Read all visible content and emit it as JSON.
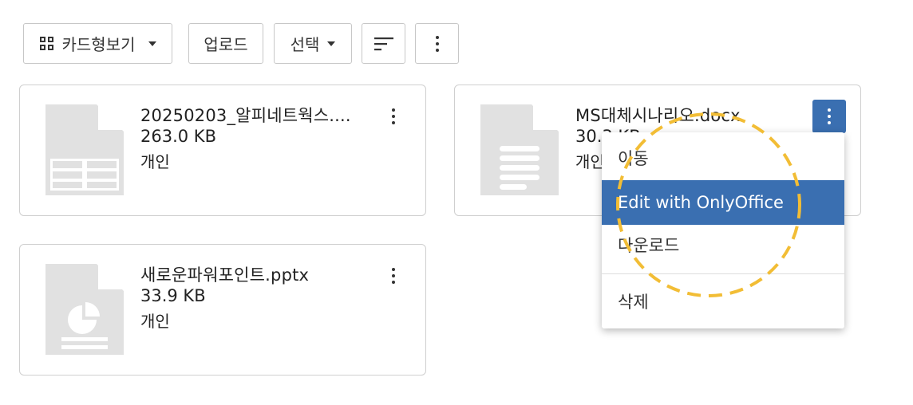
{
  "toolbar": {
    "view_label": "카드형보기",
    "upload_label": "업로드",
    "select_label": "선택"
  },
  "files": [
    {
      "name": "20250203_알피네트웍스....",
      "size": "263.0 KB",
      "owner": "개인",
      "icon": "spreadsheet-file-icon"
    },
    {
      "name": "MS대체시나리오.docx",
      "size": "30.3 KB",
      "owner": "개인",
      "icon": "document-file-icon"
    },
    {
      "name": "새로운파워포인트.pptx",
      "size": "33.9 KB",
      "owner": "개인",
      "icon": "presentation-file-icon"
    }
  ],
  "context_menu": {
    "items": [
      {
        "label": "이동"
      },
      {
        "label": "Edit with OnlyOffice",
        "highlighted": true
      },
      {
        "label": "다운로드"
      },
      {
        "label": "삭제"
      }
    ]
  },
  "colors": {
    "accent": "#3a6fb1",
    "annotation": "#f2bd35",
    "icon_gray": "#e1e1e1"
  }
}
